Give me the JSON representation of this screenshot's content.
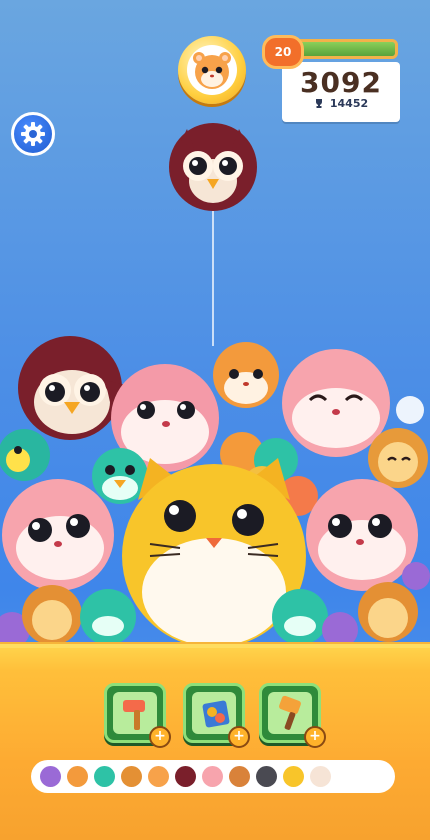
{
  "hud": {
    "level": "20",
    "level_progress": 1.0,
    "score": "3092",
    "best_score": "14452",
    "next_animal": "hamster",
    "current_drop_animal": "owl"
  },
  "icons": {
    "settings": "gear-icon",
    "trophy": "trophy-icon",
    "hammer": "hammer-icon",
    "shake": "shake-box-icon",
    "brush": "paintbrush-icon"
  },
  "tools": [
    {
      "name": "hammer",
      "plus": "+"
    },
    {
      "name": "shake",
      "plus": "+"
    },
    {
      "name": "brush",
      "plus": "+"
    }
  ],
  "evolution": [
    "purple-bird",
    "orange-hamster",
    "teal-bird",
    "hedgehog",
    "hamster",
    "owl",
    "pink-otter",
    "orange-hamster-big",
    "raccoon",
    "yellow-cat",
    "locked"
  ],
  "colors": {
    "sky_top": "#6aa6e0",
    "sky_bottom": "#3f86ea",
    "floor": "#fdaa32",
    "tool_bg": "#2f8a3a",
    "score_text": "#4a2f22"
  }
}
